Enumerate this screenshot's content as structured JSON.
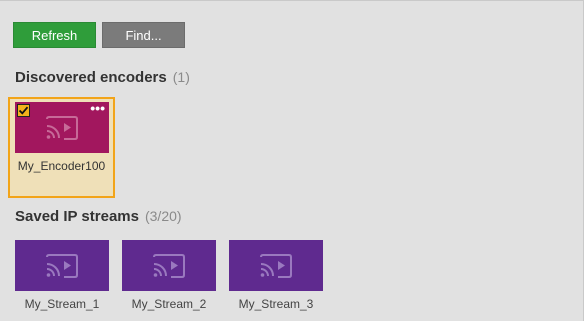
{
  "toolbar": {
    "refresh_label": "Refresh",
    "find_label": "Find..."
  },
  "discovered": {
    "title": "Discovered encoders",
    "count": "(1)",
    "items": [
      {
        "name": "My_Encoder100",
        "selected": true,
        "menu_glyph": "•••"
      }
    ]
  },
  "saved": {
    "title": "Saved IP streams",
    "count": "(3/20)",
    "items": [
      {
        "name": "My_Stream_1"
      },
      {
        "name": "My_Stream_2"
      },
      {
        "name": "My_Stream_3"
      }
    ]
  },
  "colors": {
    "refresh_button": "#2f9d3a",
    "find_button": "#7b7b7b",
    "encoder_thumb": "#a2175e",
    "stream_thumb": "#5f2a8f",
    "selection_border": "#f2a419",
    "selection_background": "#efe0b8",
    "checkbox": "#f2b21b"
  },
  "icons": {
    "thumbnail": "cast-icon",
    "checkbox": "checkmark-icon",
    "menu": "more-dots-icon"
  }
}
